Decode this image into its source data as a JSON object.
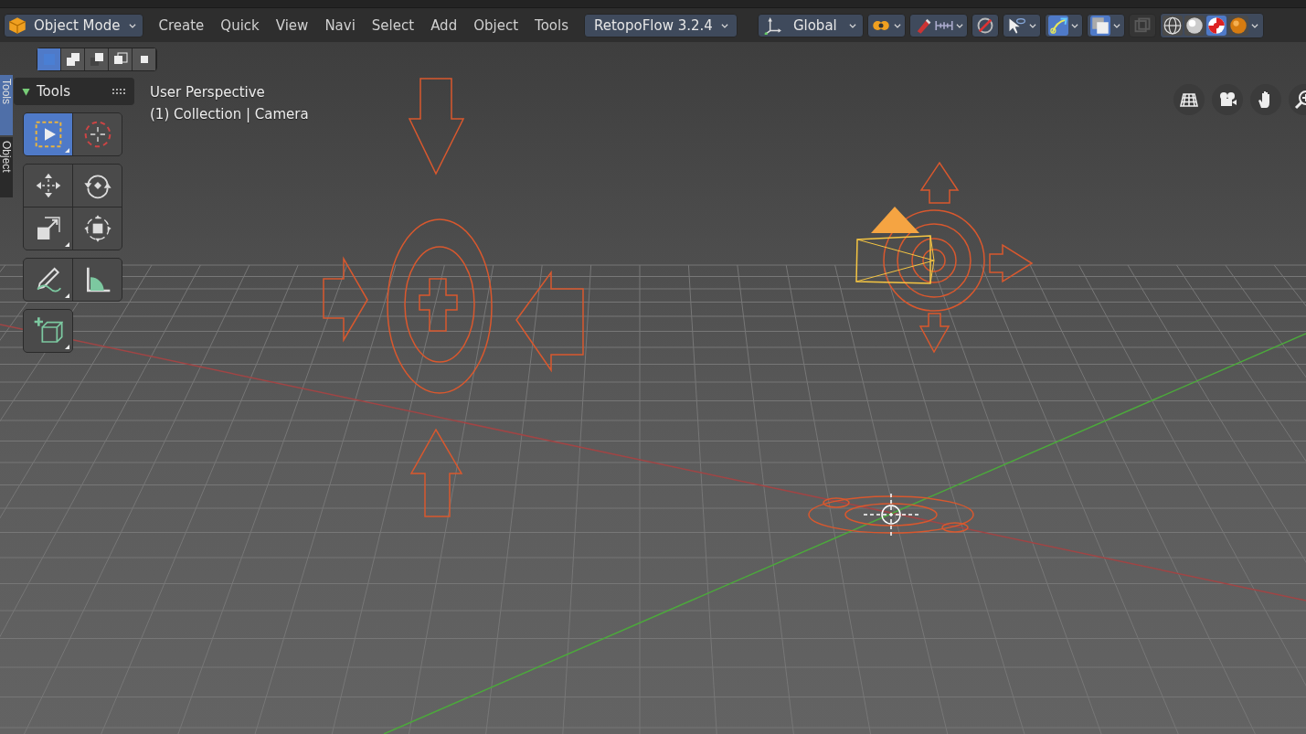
{
  "header": {
    "mode": {
      "label": "Object Mode"
    },
    "menus": [
      "Create",
      "Quick",
      "View",
      "Navi",
      "Select",
      "Add",
      "Object",
      "Tools"
    ],
    "addon": {
      "label": "RetopoFlow 3.2.4"
    },
    "orientation": {
      "label": "Global"
    },
    "toggles": [
      {
        "kind": "pivot",
        "on": false
      },
      {
        "kind": "snap",
        "on": false
      },
      {
        "kind": "proportional",
        "on": false
      },
      {
        "kind": "selectability",
        "on": false
      },
      {
        "kind": "gizmo",
        "on": true
      },
      {
        "kind": "overlay",
        "on": true
      },
      {
        "kind": "xray",
        "on": false
      }
    ],
    "shading": [
      {
        "kind": "wireframe",
        "selected": false
      },
      {
        "kind": "solid",
        "selected": false
      },
      {
        "kind": "material",
        "selected": true
      },
      {
        "kind": "rendered",
        "selected": false
      }
    ]
  },
  "select_modes": [
    {
      "kind": "set",
      "selected": true
    },
    {
      "kind": "extend",
      "selected": false
    },
    {
      "kind": "subtract",
      "selected": false
    },
    {
      "kind": "invert",
      "selected": false
    },
    {
      "kind": "intersect",
      "selected": false
    }
  ],
  "side_tabs": [
    {
      "label": "Tools",
      "selected": true
    },
    {
      "label": "Object",
      "selected": false
    }
  ],
  "tools": {
    "title": "Tools",
    "groups": [
      [
        {
          "kind": "select-box",
          "selected": true
        },
        {
          "kind": "cursor",
          "selected": false
        }
      ],
      [
        {
          "kind": "move",
          "selected": false
        },
        {
          "kind": "rotate",
          "selected": false
        },
        {
          "kind": "scale",
          "selected": false
        },
        {
          "kind": "transform",
          "selected": false
        }
      ],
      [
        {
          "kind": "annotate",
          "selected": false
        },
        {
          "kind": "measure",
          "selected": false
        }
      ],
      [
        {
          "kind": "add-cube",
          "selected": false
        }
      ]
    ]
  },
  "viewport": {
    "view_name": "User Perspective",
    "object_info": "(1) Collection | Camera"
  }
}
